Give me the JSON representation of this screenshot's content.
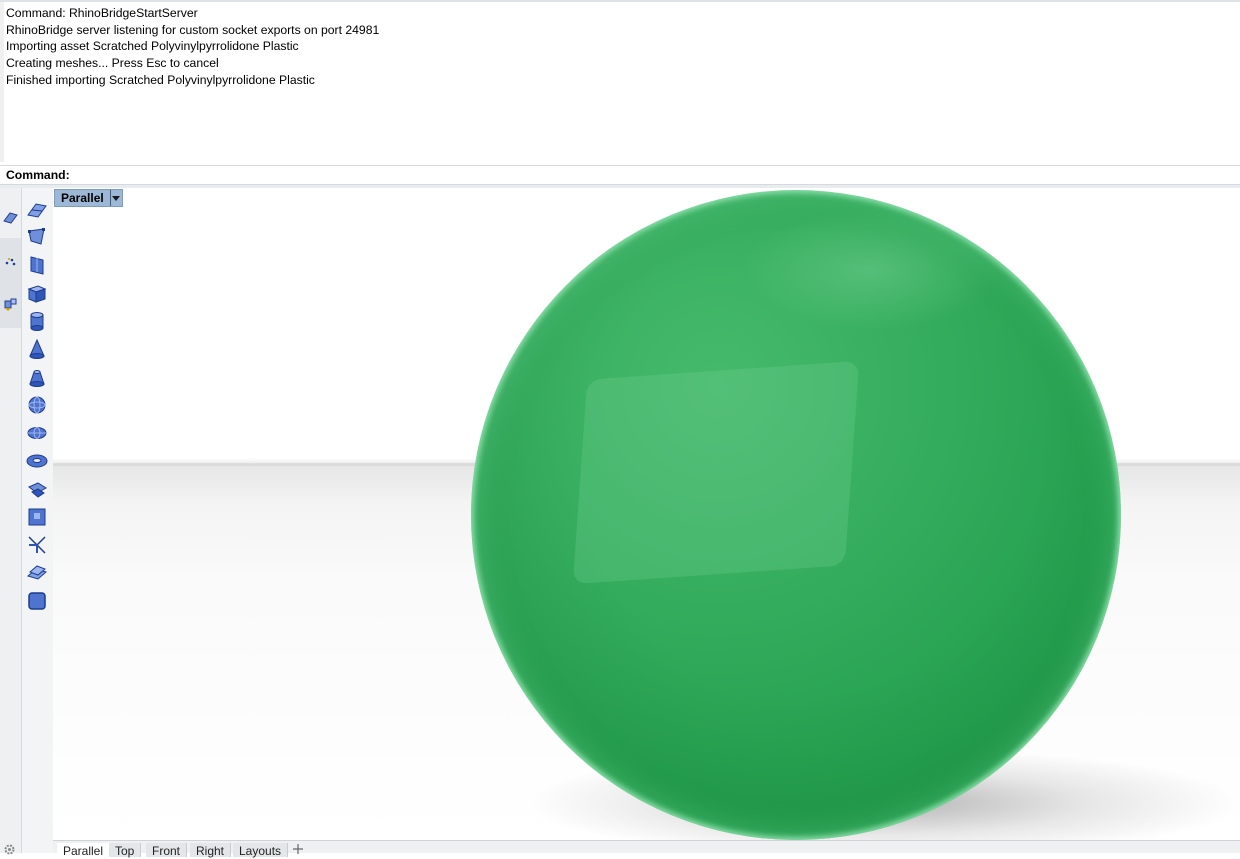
{
  "command_history": {
    "lines": [
      "Command: RhinoBridgeStartServer",
      "RhinoBridge server listening for custom socket exports on port 24981",
      "Importing asset Scratched Polyvinylpyrrolidone Plastic",
      "Creating meshes... Press Esc to cancel",
      "Finished importing Scratched Polyvinylpyrrolidone Plastic"
    ]
  },
  "command_prompt": {
    "label": "Command:"
  },
  "viewport": {
    "title": "Parallel",
    "object_color": "#27a552",
    "background_color": "#ffffff"
  },
  "toolbar": {
    "tools": [
      "plane-surface-icon",
      "corner-points-surface-icon",
      "vertical-plane-icon",
      "box-icon",
      "cylinder-icon",
      "cone-icon",
      "truncated-cone-icon",
      "sphere-icon",
      "ellipsoid-icon",
      "torus-icon",
      "ellipse-surface-icon",
      "text-object-icon",
      "heightfield-icon",
      "cut-plane-icon",
      "layout-plane-icon",
      "rounded-rectangle-icon"
    ],
    "side_tools": [
      "surface-tools-icon",
      "points-icon",
      "gumball-icon"
    ]
  },
  "view_tabs": {
    "items": [
      {
        "label": "Parallel",
        "active": true
      },
      {
        "label": "Top",
        "active": false
      },
      {
        "label": "Front",
        "active": false
      },
      {
        "label": "Right",
        "active": false
      },
      {
        "label": "Layouts",
        "active": false
      }
    ],
    "add_icon": "add-tab-icon"
  }
}
